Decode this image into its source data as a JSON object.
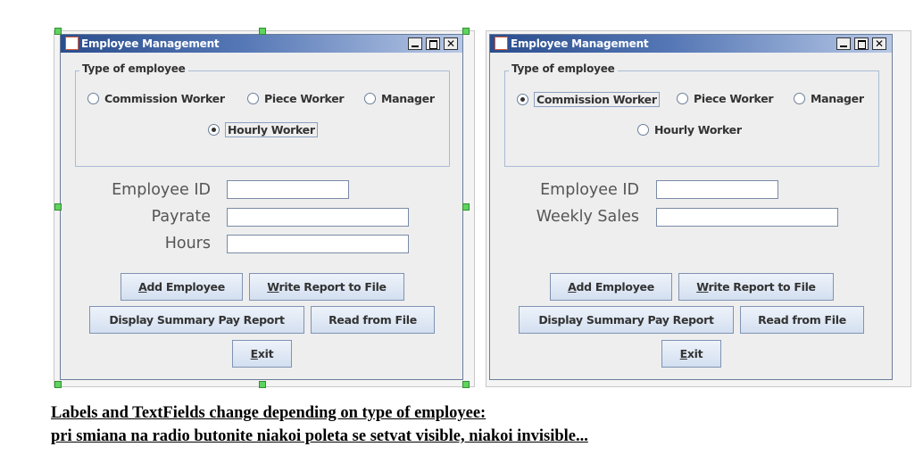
{
  "windows": [
    {
      "title": "Employee Management",
      "group_title": "Type of employee",
      "radios": [
        {
          "label": "Commission Worker",
          "checked": false
        },
        {
          "label": "Piece Worker",
          "checked": false
        },
        {
          "label": "Manager",
          "checked": false
        },
        {
          "label": "Hourly Worker",
          "checked": true
        }
      ],
      "fields": [
        {
          "label": "Employee ID",
          "value": ""
        },
        {
          "label": "Payrate",
          "value": ""
        },
        {
          "label": "Hours",
          "value": ""
        }
      ],
      "buttons": {
        "add": {
          "mnemonic": "A",
          "rest": "dd Employee"
        },
        "write": {
          "mnemonic": "W",
          "rest": "rite Report to File"
        },
        "display": "Display Summary Pay Report",
        "read": "Read from File",
        "exit": {
          "mnemonic": "E",
          "rest": "xit"
        }
      }
    },
    {
      "title": "Employee Management",
      "group_title": "Type of employee",
      "radios": [
        {
          "label": "Commission Worker",
          "checked": true
        },
        {
          "label": "Piece Worker",
          "checked": false
        },
        {
          "label": "Manager",
          "checked": false
        },
        {
          "label": "Hourly Worker",
          "checked": false
        }
      ],
      "fields": [
        {
          "label": "Employee ID",
          "value": ""
        },
        {
          "label": "Weekly Sales",
          "value": ""
        }
      ],
      "buttons": {
        "add": {
          "mnemonic": "A",
          "rest": "dd Employee"
        },
        "write": {
          "mnemonic": "W",
          "rest": "rite Report to File"
        },
        "display": "Display Summary Pay Report",
        "read": "Read from File",
        "exit": {
          "mnemonic": "E",
          "rest": "xit"
        }
      }
    }
  ],
  "caption": {
    "line1": "Labels and TextFields change depending on type of employee:",
    "line2": "pri smiana na radio butonite niakoi poleta se setvat visible, niakoi invisible... "
  },
  "colors": {
    "titlebar_start": "#2a4d8d",
    "titlebar_end": "#b7c8e6",
    "window_bg": "#eeeeee",
    "selection_handle": "#5fd35f"
  }
}
